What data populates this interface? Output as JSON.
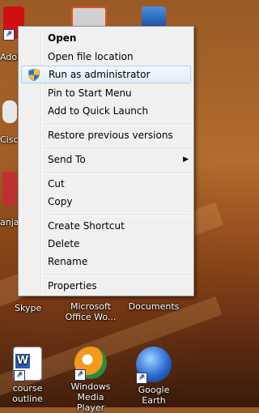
{
  "desktop_icons": [
    {
      "key": "adobe",
      "label": "Adol",
      "icon": "adobe-pdf-icon"
    },
    {
      "key": "cisco",
      "label": "Cisco",
      "icon": "cisco-icon"
    },
    {
      "key": "raja",
      "label": "anja",
      "icon": "red-file-icon"
    },
    {
      "key": "skype",
      "label": "Skype",
      "icon": "skype-icon"
    },
    {
      "key": "office",
      "label": "Microsoft Office Wo...",
      "icon": "office-icon"
    },
    {
      "key": "documents",
      "label": "Documents",
      "icon": "folder-icon"
    },
    {
      "key": "course",
      "label": "course outline",
      "icon": "word-doc-icon"
    },
    {
      "key": "wmp",
      "label": "Windows Media Player",
      "icon": "media-player-icon"
    },
    {
      "key": "gearth",
      "label": "Google Earth",
      "icon": "google-earth-icon"
    }
  ],
  "context_menu": {
    "items": [
      {
        "label": "Open"
      },
      {
        "label": "Open file location"
      },
      {
        "label": "Run as administrator",
        "icon": "uac-shield-icon"
      },
      {
        "label": "Pin to Start Menu"
      },
      {
        "label": "Add to Quick Launch"
      },
      {
        "label": "Restore previous versions"
      },
      {
        "label": "Send To",
        "submenu": "submenu-arrow-icon"
      },
      {
        "label": "Cut"
      },
      {
        "label": "Copy"
      },
      {
        "label": "Create Shortcut"
      },
      {
        "label": "Delete"
      },
      {
        "label": "Rename"
      },
      {
        "label": "Properties"
      }
    ]
  },
  "colors": {
    "highlight_border": "#aecff7",
    "menu_bg": "#f0f0f0"
  }
}
